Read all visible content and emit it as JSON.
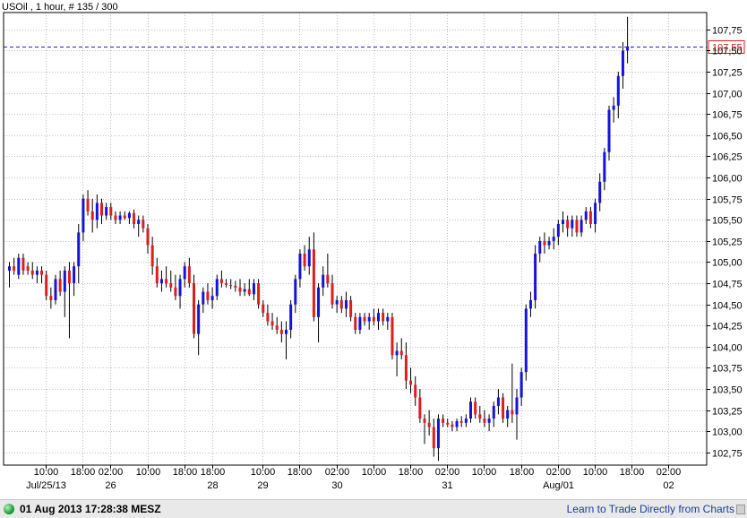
{
  "header": {
    "title": "USOil , 1 hour, # 135 / 300"
  },
  "status": {
    "time": "01 Aug 2013 17:28:38 MESZ",
    "link": "Learn to Trade Directly from Charts"
  },
  "colors": {
    "up": "#1414d8",
    "down": "#dc1e1e",
    "wick": "#000000",
    "grid": "#c0c0c0",
    "priceLine": "#2020c8",
    "priceBox": "#dc1e1e"
  },
  "icons": {
    "status": "green-circle-icon",
    "corner": "resize-grip-icon"
  },
  "chart_data": {
    "type": "candlestick",
    "title": "USOil , 1 hour, # 135 / 300",
    "ylim": [
      102.6,
      107.95
    ],
    "grid": true,
    "y_ticks": [
      "107,75",
      "107,50",
      "107,25",
      "107,00",
      "106,75",
      "106,50",
      "106,25",
      "106,00",
      "105,75",
      "105,50",
      "105,25",
      "105,00",
      "104,75",
      "104,50",
      "104,25",
      "104,00",
      "103,75",
      "103,50",
      "103,25",
      "103,00",
      "102,75"
    ],
    "y_tick_values": [
      107.75,
      107.5,
      107.25,
      107.0,
      106.75,
      106.5,
      106.25,
      106.0,
      105.75,
      105.5,
      105.25,
      105.0,
      104.75,
      104.5,
      104.25,
      104.0,
      103.75,
      103.5,
      103.25,
      103.0,
      102.75
    ],
    "current_price": {
      "value": 107.55,
      "label": "107,55"
    },
    "x_labels": [
      {
        "i": 8,
        "top": "10:00",
        "bottom": "Jul/25/13"
      },
      {
        "i": 16,
        "top": "18:00",
        "bottom": ""
      },
      {
        "i": 22,
        "top": "02:00",
        "bottom": "26"
      },
      {
        "i": 30,
        "top": "10:00",
        "bottom": ""
      },
      {
        "i": 38,
        "top": "18:00",
        "bottom": ""
      },
      {
        "i": 44,
        "top": "18:00",
        "bottom": "28"
      },
      {
        "i": 55,
        "top": "10:00",
        "bottom": "29"
      },
      {
        "i": 63,
        "top": "18:00",
        "bottom": ""
      },
      {
        "i": 71,
        "top": "02:00",
        "bottom": "30"
      },
      {
        "i": 79,
        "top": "10:00",
        "bottom": ""
      },
      {
        "i": 87,
        "top": "18:00",
        "bottom": ""
      },
      {
        "i": 95,
        "top": "02:00",
        "bottom": "31"
      },
      {
        "i": 103,
        "top": "10:00",
        "bottom": ""
      },
      {
        "i": 111,
        "top": "18:00",
        "bottom": ""
      },
      {
        "i": 119,
        "top": "02:00",
        "bottom": "Aug/01"
      },
      {
        "i": 127,
        "top": "10:00",
        "bottom": ""
      },
      {
        "i": 135,
        "top": "18:00",
        "bottom": ""
      },
      {
        "i": 143,
        "top": "02:00",
        "bottom": "02"
      }
    ],
    "candles": [
      {
        "o": 104.9,
        "h": 105.0,
        "l": 104.7,
        "c": 104.95
      },
      {
        "o": 104.95,
        "h": 105.05,
        "l": 104.85,
        "c": 104.9
      },
      {
        "o": 104.85,
        "h": 105.1,
        "l": 104.8,
        "c": 105.05
      },
      {
        "o": 105.05,
        "h": 105.1,
        "l": 104.85,
        "c": 104.9
      },
      {
        "o": 104.95,
        "h": 105.0,
        "l": 104.85,
        "c": 104.9
      },
      {
        "o": 104.9,
        "h": 105.0,
        "l": 104.8,
        "c": 104.85
      },
      {
        "o": 104.85,
        "h": 104.95,
        "l": 104.75,
        "c": 104.9
      },
      {
        "o": 104.9,
        "h": 104.95,
        "l": 104.75,
        "c": 104.85
      },
      {
        "o": 104.85,
        "h": 104.9,
        "l": 104.55,
        "c": 104.6
      },
      {
        "o": 104.6,
        "h": 104.7,
        "l": 104.45,
        "c": 104.55
      },
      {
        "o": 104.55,
        "h": 104.85,
        "l": 104.5,
        "c": 104.8
      },
      {
        "o": 104.8,
        "h": 104.9,
        "l": 104.6,
        "c": 104.65
      },
      {
        "o": 104.65,
        "h": 104.95,
        "l": 104.35,
        "c": 104.9
      },
      {
        "o": 104.9,
        "h": 105.0,
        "l": 104.1,
        "c": 104.75
      },
      {
        "o": 104.75,
        "h": 105.0,
        "l": 104.6,
        "c": 104.95
      },
      {
        "o": 104.95,
        "h": 105.45,
        "l": 104.75,
        "c": 105.35
      },
      {
        "o": 105.35,
        "h": 105.8,
        "l": 105.25,
        "c": 105.75
      },
      {
        "o": 105.75,
        "h": 105.85,
        "l": 105.55,
        "c": 105.6
      },
      {
        "o": 105.6,
        "h": 105.75,
        "l": 105.35,
        "c": 105.5
      },
      {
        "o": 105.5,
        "h": 105.8,
        "l": 105.4,
        "c": 105.7
      },
      {
        "o": 105.7,
        "h": 105.75,
        "l": 105.45,
        "c": 105.55
      },
      {
        "o": 105.55,
        "h": 105.7,
        "l": 105.5,
        "c": 105.65
      },
      {
        "o": 105.65,
        "h": 105.7,
        "l": 105.5,
        "c": 105.55
      },
      {
        "o": 105.55,
        "h": 105.6,
        "l": 105.45,
        "c": 105.5
      },
      {
        "o": 105.5,
        "h": 105.6,
        "l": 105.45,
        "c": 105.55
      },
      {
        "o": 105.55,
        "h": 105.6,
        "l": 105.5,
        "c": 105.52
      },
      {
        "o": 105.52,
        "h": 105.6,
        "l": 105.45,
        "c": 105.58
      },
      {
        "o": 105.58,
        "h": 105.62,
        "l": 105.4,
        "c": 105.45
      },
      {
        "o": 105.45,
        "h": 105.55,
        "l": 105.3,
        "c": 105.5
      },
      {
        "o": 105.5,
        "h": 105.55,
        "l": 105.35,
        "c": 105.4
      },
      {
        "o": 105.4,
        "h": 105.45,
        "l": 105.1,
        "c": 105.2
      },
      {
        "o": 105.2,
        "h": 105.3,
        "l": 104.85,
        "c": 104.95
      },
      {
        "o": 104.95,
        "h": 105.05,
        "l": 104.7,
        "c": 104.75
      },
      {
        "o": 104.75,
        "h": 104.9,
        "l": 104.65,
        "c": 104.8
      },
      {
        "o": 104.8,
        "h": 104.95,
        "l": 104.7,
        "c": 104.75
      },
      {
        "o": 104.75,
        "h": 104.9,
        "l": 104.65,
        "c": 104.7
      },
      {
        "o": 104.7,
        "h": 104.85,
        "l": 104.55,
        "c": 104.6
      },
      {
        "o": 104.6,
        "h": 104.85,
        "l": 104.45,
        "c": 104.8
      },
      {
        "o": 104.8,
        "h": 105.0,
        "l": 104.7,
        "c": 104.95
      },
      {
        "o": 104.95,
        "h": 105.05,
        "l": 104.7,
        "c": 104.75
      },
      {
        "o": 104.75,
        "h": 104.85,
        "l": 104.1,
        "c": 104.15
      },
      {
        "o": 104.15,
        "h": 104.55,
        "l": 103.9,
        "c": 104.5
      },
      {
        "o": 104.5,
        "h": 104.7,
        "l": 104.4,
        "c": 104.65
      },
      {
        "o": 104.65,
        "h": 104.75,
        "l": 104.5,
        "c": 104.55
      },
      {
        "o": 104.55,
        "h": 104.7,
        "l": 104.45,
        "c": 104.6
      },
      {
        "o": 104.6,
        "h": 104.85,
        "l": 104.55,
        "c": 104.8
      },
      {
        "o": 104.8,
        "h": 104.9,
        "l": 104.7,
        "c": 104.75
      },
      {
        "o": 104.75,
        "h": 104.8,
        "l": 104.7,
        "c": 104.73
      },
      {
        "o": 104.73,
        "h": 104.8,
        "l": 104.68,
        "c": 104.72
      },
      {
        "o": 104.72,
        "h": 104.78,
        "l": 104.65,
        "c": 104.7
      },
      {
        "o": 104.7,
        "h": 104.8,
        "l": 104.6,
        "c": 104.65
      },
      {
        "o": 104.65,
        "h": 104.75,
        "l": 104.6,
        "c": 104.68
      },
      {
        "o": 104.68,
        "h": 104.8,
        "l": 104.6,
        "c": 104.62
      },
      {
        "o": 104.62,
        "h": 104.8,
        "l": 104.55,
        "c": 104.75
      },
      {
        "o": 104.75,
        "h": 104.8,
        "l": 104.45,
        "c": 104.5
      },
      {
        "o": 104.5,
        "h": 104.55,
        "l": 104.35,
        "c": 104.4
      },
      {
        "o": 104.4,
        "h": 104.5,
        "l": 104.25,
        "c": 104.3
      },
      {
        "o": 104.3,
        "h": 104.4,
        "l": 104.2,
        "c": 104.25
      },
      {
        "o": 104.25,
        "h": 104.35,
        "l": 104.15,
        "c": 104.2
      },
      {
        "o": 104.2,
        "h": 104.3,
        "l": 104.05,
        "c": 104.15
      },
      {
        "o": 104.15,
        "h": 104.3,
        "l": 103.85,
        "c": 104.2
      },
      {
        "o": 104.2,
        "h": 104.55,
        "l": 104.1,
        "c": 104.5
      },
      {
        "o": 104.5,
        "h": 104.85,
        "l": 104.4,
        "c": 104.8
      },
      {
        "o": 104.8,
        "h": 105.15,
        "l": 104.7,
        "c": 105.1
      },
      {
        "o": 105.1,
        "h": 105.2,
        "l": 104.9,
        "c": 104.95
      },
      {
        "o": 104.95,
        "h": 105.3,
        "l": 104.85,
        "c": 105.15
      },
      {
        "o": 105.15,
        "h": 105.35,
        "l": 104.3,
        "c": 104.35
      },
      {
        "o": 104.35,
        "h": 104.75,
        "l": 104.05,
        "c": 104.7
      },
      {
        "o": 104.7,
        "h": 104.95,
        "l": 104.6,
        "c": 104.85
      },
      {
        "o": 104.85,
        "h": 105.1,
        "l": 104.7,
        "c": 104.75
      },
      {
        "o": 104.75,
        "h": 104.85,
        "l": 104.45,
        "c": 104.5
      },
      {
        "o": 104.5,
        "h": 104.6,
        "l": 104.4,
        "c": 104.55
      },
      {
        "o": 104.55,
        "h": 104.6,
        "l": 104.4,
        "c": 104.45
      },
      {
        "o": 104.45,
        "h": 104.65,
        "l": 104.35,
        "c": 104.55
      },
      {
        "o": 104.55,
        "h": 104.6,
        "l": 104.3,
        "c": 104.35
      },
      {
        "o": 104.35,
        "h": 104.4,
        "l": 104.15,
        "c": 104.2
      },
      {
        "o": 104.2,
        "h": 104.4,
        "l": 104.15,
        "c": 104.35
      },
      {
        "o": 104.35,
        "h": 104.4,
        "l": 104.25,
        "c": 104.3
      },
      {
        "o": 104.3,
        "h": 104.4,
        "l": 104.2,
        "c": 104.35
      },
      {
        "o": 104.35,
        "h": 104.45,
        "l": 104.25,
        "c": 104.3
      },
      {
        "o": 104.3,
        "h": 104.45,
        "l": 104.2,
        "c": 104.4
      },
      {
        "o": 104.4,
        "h": 104.45,
        "l": 104.25,
        "c": 104.3
      },
      {
        "o": 104.3,
        "h": 104.4,
        "l": 104.2,
        "c": 104.35
      },
      {
        "o": 104.35,
        "h": 104.4,
        "l": 103.85,
        "c": 103.9
      },
      {
        "o": 103.9,
        "h": 104.05,
        "l": 103.65,
        "c": 103.95
      },
      {
        "o": 103.95,
        "h": 104.1,
        "l": 103.85,
        "c": 103.9
      },
      {
        "o": 103.9,
        "h": 104.05,
        "l": 103.5,
        "c": 103.6
      },
      {
        "o": 103.6,
        "h": 103.75,
        "l": 103.45,
        "c": 103.55
      },
      {
        "o": 103.55,
        "h": 103.65,
        "l": 103.3,
        "c": 103.4
      },
      {
        "o": 103.4,
        "h": 103.5,
        "l": 103.1,
        "c": 103.15
      },
      {
        "o": 103.15,
        "h": 103.2,
        "l": 102.85,
        "c": 103.1
      },
      {
        "o": 103.1,
        "h": 103.25,
        "l": 102.95,
        "c": 103.05
      },
      {
        "o": 103.05,
        "h": 103.15,
        "l": 102.7,
        "c": 102.8
      },
      {
        "o": 102.8,
        "h": 103.2,
        "l": 102.65,
        "c": 103.15
      },
      {
        "o": 103.15,
        "h": 103.2,
        "l": 103.05,
        "c": 103.1
      },
      {
        "o": 103.1,
        "h": 103.15,
        "l": 103.05,
        "c": 103.08
      },
      {
        "o": 103.08,
        "h": 103.12,
        "l": 103.0,
        "c": 103.05
      },
      {
        "o": 103.05,
        "h": 103.15,
        "l": 103.0,
        "c": 103.12
      },
      {
        "o": 103.12,
        "h": 103.18,
        "l": 103.05,
        "c": 103.1
      },
      {
        "o": 103.1,
        "h": 103.2,
        "l": 103.05,
        "c": 103.15
      },
      {
        "o": 103.15,
        "h": 103.4,
        "l": 103.1,
        "c": 103.35
      },
      {
        "o": 103.35,
        "h": 103.4,
        "l": 103.15,
        "c": 103.2
      },
      {
        "o": 103.2,
        "h": 103.3,
        "l": 103.1,
        "c": 103.15
      },
      {
        "o": 103.15,
        "h": 103.25,
        "l": 103.05,
        "c": 103.1
      },
      {
        "o": 103.1,
        "h": 103.2,
        "l": 103.0,
        "c": 103.15
      },
      {
        "o": 103.15,
        "h": 103.35,
        "l": 103.05,
        "c": 103.3
      },
      {
        "o": 103.3,
        "h": 103.5,
        "l": 103.2,
        "c": 103.4
      },
      {
        "o": 103.4,
        "h": 103.45,
        "l": 103.1,
        "c": 103.15
      },
      {
        "o": 103.15,
        "h": 103.3,
        "l": 103.05,
        "c": 103.25
      },
      {
        "o": 103.25,
        "h": 103.8,
        "l": 103.1,
        "c": 103.2
      },
      {
        "o": 103.2,
        "h": 103.5,
        "l": 102.9,
        "c": 103.4
      },
      {
        "o": 103.4,
        "h": 103.75,
        "l": 103.3,
        "c": 103.7
      },
      {
        "o": 103.7,
        "h": 104.5,
        "l": 103.6,
        "c": 104.45
      },
      {
        "o": 104.45,
        "h": 104.65,
        "l": 104.35,
        "c": 104.55
      },
      {
        "o": 104.55,
        "h": 105.2,
        "l": 104.45,
        "c": 105.1
      },
      {
        "o": 105.1,
        "h": 105.3,
        "l": 105.0,
        "c": 105.25
      },
      {
        "o": 105.25,
        "h": 105.35,
        "l": 105.1,
        "c": 105.2
      },
      {
        "o": 105.2,
        "h": 105.3,
        "l": 105.15,
        "c": 105.25
      },
      {
        "o": 105.25,
        "h": 105.4,
        "l": 105.15,
        "c": 105.3
      },
      {
        "o": 105.3,
        "h": 105.5,
        "l": 105.2,
        "c": 105.45
      },
      {
        "o": 105.45,
        "h": 105.6,
        "l": 105.35,
        "c": 105.5
      },
      {
        "o": 105.5,
        "h": 105.55,
        "l": 105.3,
        "c": 105.4
      },
      {
        "o": 105.4,
        "h": 105.55,
        "l": 105.3,
        "c": 105.5
      },
      {
        "o": 105.5,
        "h": 105.55,
        "l": 105.3,
        "c": 105.35
      },
      {
        "o": 105.35,
        "h": 105.55,
        "l": 105.3,
        "c": 105.5
      },
      {
        "o": 105.5,
        "h": 105.65,
        "l": 105.45,
        "c": 105.6
      },
      {
        "o": 105.6,
        "h": 105.65,
        "l": 105.4,
        "c": 105.45
      },
      {
        "o": 105.45,
        "h": 105.75,
        "l": 105.35,
        "c": 105.7
      },
      {
        "o": 105.7,
        "h": 106.05,
        "l": 105.6,
        "c": 105.95
      },
      {
        "o": 105.95,
        "h": 106.35,
        "l": 105.85,
        "c": 106.3
      },
      {
        "o": 106.3,
        "h": 106.85,
        "l": 106.2,
        "c": 106.8
      },
      {
        "o": 106.8,
        "h": 106.95,
        "l": 106.65,
        "c": 106.85
      },
      {
        "o": 106.85,
        "h": 107.25,
        "l": 106.7,
        "c": 107.2
      },
      {
        "o": 107.2,
        "h": 107.6,
        "l": 107.05,
        "c": 107.5
      },
      {
        "o": 107.5,
        "h": 107.9,
        "l": 107.35,
        "c": 107.55
      }
    ]
  }
}
